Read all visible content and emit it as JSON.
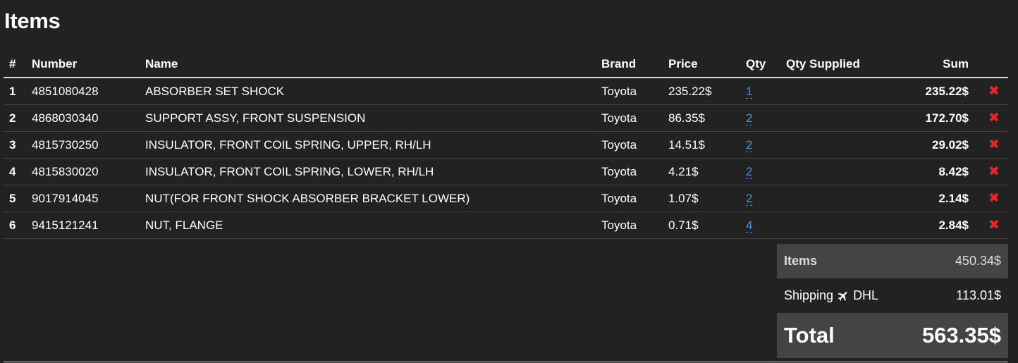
{
  "title": "Items",
  "table": {
    "headers": [
      "#",
      "Number",
      "Name",
      "Brand",
      "Price",
      "Qty",
      "Qty Supplied",
      "Sum"
    ],
    "rows": [
      {
        "idx": "1",
        "number": "4851080428",
        "name": "ABSORBER SET SHOCK",
        "brand": "Toyota",
        "price": "235.22$",
        "qty": "1",
        "qty_supplied": "",
        "sum": "235.22$"
      },
      {
        "idx": "2",
        "number": "4868030340",
        "name": "SUPPORT ASSY, FRONT SUSPENSION",
        "brand": "Toyota",
        "price": "86.35$",
        "qty": "2",
        "qty_supplied": "",
        "sum": "172.70$"
      },
      {
        "idx": "3",
        "number": "4815730250",
        "name": "INSULATOR, FRONT COIL SPRING, UPPER, RH/LH",
        "brand": "Toyota",
        "price": "14.51$",
        "qty": "2",
        "qty_supplied": "",
        "sum": "29.02$"
      },
      {
        "idx": "4",
        "number": "4815830020",
        "name": "INSULATOR, FRONT COIL SPRING, LOWER, RH/LH",
        "brand": "Toyota",
        "price": "4.21$",
        "qty": "2",
        "qty_supplied": "",
        "sum": "8.42$"
      },
      {
        "idx": "5",
        "number": "9017914045",
        "name": "NUT(FOR FRONT SHOCK ABSORBER BRACKET LOWER)",
        "brand": "Toyota",
        "price": "1.07$",
        "qty": "2",
        "qty_supplied": "",
        "sum": "2.14$"
      },
      {
        "idx": "6",
        "number": "9415121241",
        "name": "NUT, FLANGE",
        "brand": "Toyota",
        "price": "0.71$",
        "qty": "4",
        "qty_supplied": "",
        "sum": "2.84$"
      }
    ],
    "delete_icon": "close-icon",
    "delete_glyph": "✖"
  },
  "summary": {
    "items_label": "Items",
    "items_value": "450.34$",
    "shipping_label": "Shipping",
    "shipping_carrier": "DHL",
    "shipping_icon": "plane-icon",
    "shipping_value": "113.01$",
    "total_label": "Total",
    "total_value": "563.35$"
  },
  "colors": {
    "background": "#222222",
    "link": "#4a90d9",
    "delete": "#e8262c",
    "summary_bg": "#444444"
  }
}
